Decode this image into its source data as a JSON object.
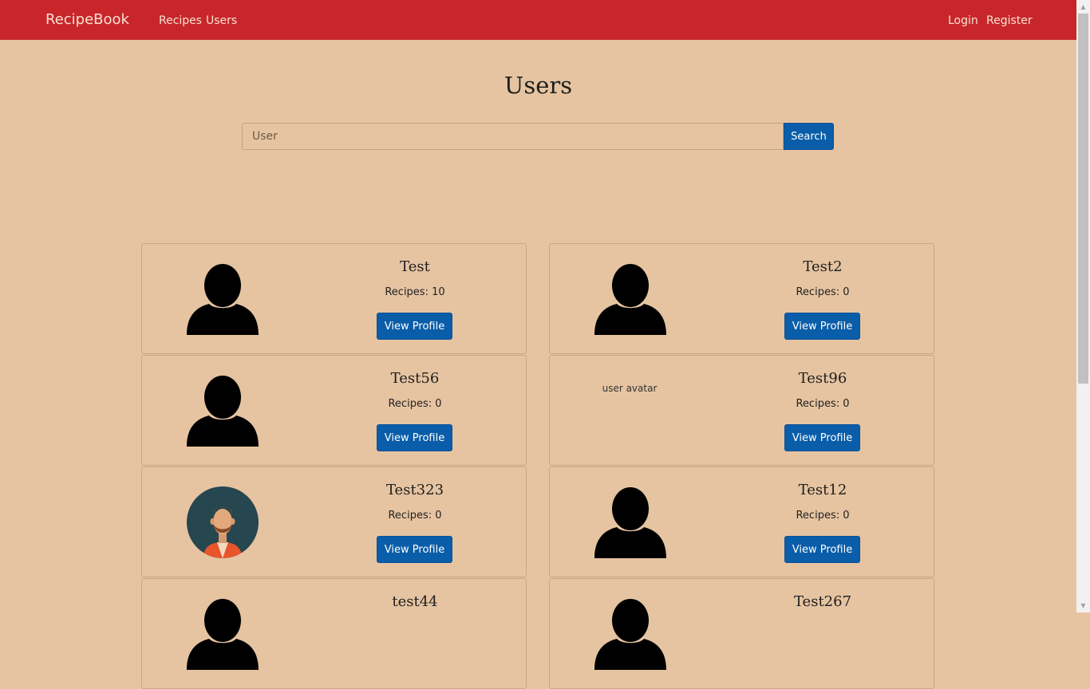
{
  "navbar": {
    "brand": "RecipeBook",
    "links": [
      "Recipes",
      "Users"
    ],
    "login": "Login",
    "register": "Register"
  },
  "page": {
    "title": "Users"
  },
  "search": {
    "placeholder": "User",
    "value": "",
    "button": "Search"
  },
  "view_profile_label": "View Profile",
  "users": [
    {
      "name": "Test",
      "recipes": "Recipes: 10",
      "avatar": "silhouette-icon"
    },
    {
      "name": "Test2",
      "recipes": "Recipes: 0",
      "avatar": "silhouette-icon"
    },
    {
      "name": "Test56",
      "recipes": "Recipes: 0",
      "avatar": "silhouette-icon"
    },
    {
      "name": "Test96",
      "recipes": "Recipes: 0",
      "avatar": "broken-image",
      "avatar_alt": "user avatar"
    },
    {
      "name": "Test323",
      "recipes": "Recipes: 0",
      "avatar": "bearded-man-avatar"
    },
    {
      "name": "Test12",
      "recipes": "Recipes: 0",
      "avatar": "silhouette-icon"
    },
    {
      "name": "test44",
      "recipes": "",
      "avatar": "silhouette-icon"
    },
    {
      "name": "Test267",
      "recipes": "",
      "avatar": "silhouette-icon"
    }
  ],
  "colors": {
    "navbar": "#c9262c",
    "background": "#e6c4a1",
    "button": "#0a5da8"
  }
}
